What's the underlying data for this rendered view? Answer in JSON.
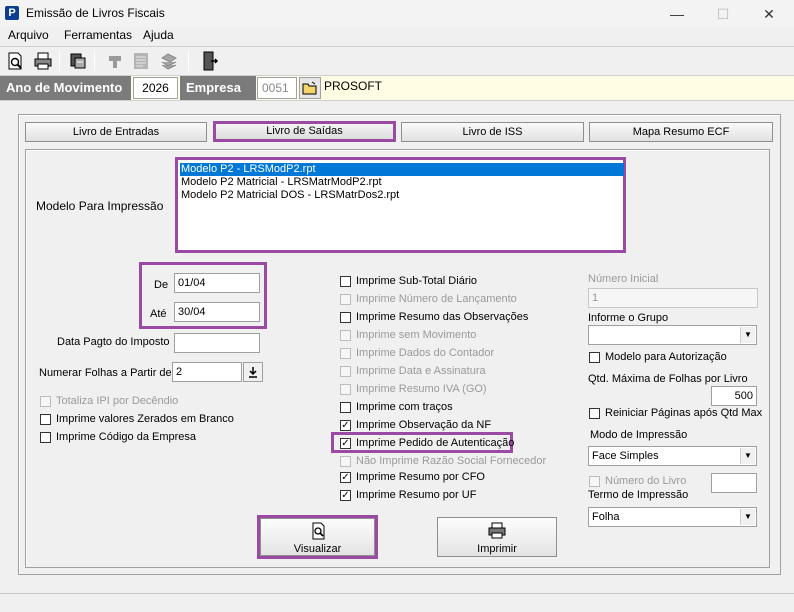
{
  "window": {
    "icon_letter": "P",
    "title": "Emissão de Livros Fiscais",
    "minimize": "—",
    "maximize": "☐",
    "close": "✕"
  },
  "menu": [
    "Arquivo",
    "Ferramentas",
    "Ajuda"
  ],
  "toolbar": {
    "icons": [
      "print-preview-icon",
      "printer-icon",
      "export-icon",
      "pointer-icon",
      "document-icon",
      "stack-icon",
      "exit-door-icon"
    ]
  },
  "header": {
    "ano_label": "Ano de Movimento",
    "ano_value": "2026",
    "empresa_label": "Empresa",
    "empresa_code": "0051",
    "empresa_name": "PROSOFT"
  },
  "tabs": [
    "Livro de Entradas",
    "Livro de Saídas",
    "Livro de ISS",
    "Mapa Resumo ECF"
  ],
  "active_tab": "Livro de Saídas",
  "modelo": {
    "label": "Modelo Para Impressão",
    "items": [
      "Modelo P2 - LRSModP2.rpt",
      "Modelo P2 Matricial - LRSMatrModP2.rpt",
      "Modelo P2 Matricial DOS - LRSMatrDos2.rpt"
    ],
    "selected_index": 0
  },
  "periodo": {
    "de_label": "De",
    "de_value": "01/04",
    "ate_label": "Até",
    "ate_value": "30/04"
  },
  "data_pagto": {
    "label": "Data Pagto do Imposto",
    "value": ""
  },
  "numerar": {
    "label": "Numerar Folhas a Partir de",
    "value": "2"
  },
  "left_checks": [
    {
      "label": "Totaliza IPI por Decêndio",
      "checked": false,
      "enabled": false
    },
    {
      "label": "Imprime valores Zerados em Branco",
      "checked": false,
      "enabled": true
    },
    {
      "label": "Imprime Código da Empresa",
      "checked": false,
      "enabled": true
    }
  ],
  "middle_checks": [
    {
      "label": "Imprime Sub-Total Diário",
      "checked": false,
      "enabled": true
    },
    {
      "label": "Imprime Número de Lançamento",
      "checked": false,
      "enabled": false
    },
    {
      "label": "Imprime Resumo das Observações",
      "checked": false,
      "enabled": true
    },
    {
      "label": "Imprime sem Movimento",
      "checked": false,
      "enabled": false
    },
    {
      "label": "Imprime Dados do Contador",
      "checked": false,
      "enabled": false
    },
    {
      "label": "Imprime Data e Assinatura",
      "checked": false,
      "enabled": false
    },
    {
      "label": "Imprime Resumo IVA (GO)",
      "checked": false,
      "enabled": false
    },
    {
      "label": "Imprime com traços",
      "checked": false,
      "enabled": true
    },
    {
      "label": "Imprime Observação da NF",
      "checked": true,
      "enabled": true
    },
    {
      "label": "Imprime Pedido de Autenticação",
      "checked": true,
      "enabled": true
    },
    {
      "label": "Não Imprime Razão Social Fornecedor",
      "checked": false,
      "enabled": false
    },
    {
      "label": "Imprime Resumo por CFO",
      "checked": true,
      "enabled": true
    },
    {
      "label": "Imprime Resumo por UF",
      "checked": true,
      "enabled": true
    }
  ],
  "right": {
    "numero_inicial_label": "Número Inicial",
    "numero_inicial_value": "1",
    "grupo_label": "Informe o Grupo",
    "grupo_value": "",
    "modelo_autorizacao": "Modelo para Autorização",
    "qtd_max_label": "Qtd. Máxima de Folhas por Livro",
    "qtd_max_value": "500",
    "reiniciar_label": "Reiniciar Páginas após Qtd Max",
    "modo_label": "Modo de Impressão",
    "modo_value": "Face Simples",
    "numero_livro_label": "Número do Livro",
    "numero_livro_value": "",
    "termo_label": "Termo de Impressão",
    "termo_value": "Folha"
  },
  "buttons": {
    "visualizar": "Visualizar",
    "imprimir": "Imprimir"
  },
  "colors": {
    "highlight": "#9b4aa3",
    "selection": "#0078d7",
    "header_label_bg": "#7b7b7b",
    "header_strip_bg": "#fffde3"
  }
}
